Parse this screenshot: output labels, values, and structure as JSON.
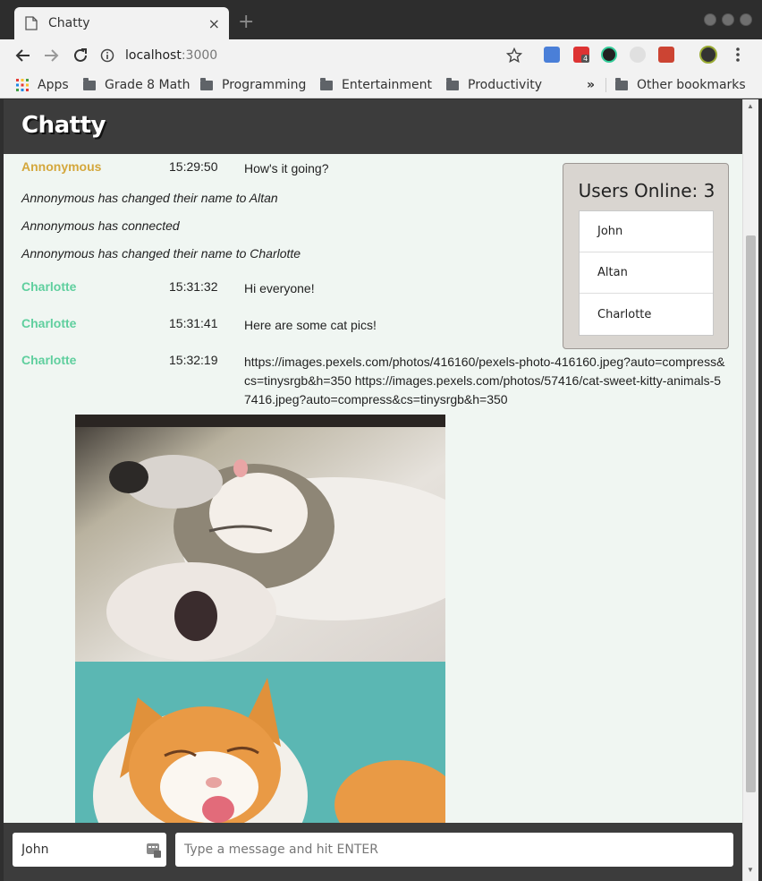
{
  "browser": {
    "tab_title": "Chatty",
    "new_tab_symbol": "+",
    "url_host": "localhost",
    "url_port": ":3000",
    "bookmarks": [
      "Apps",
      "Grade 8 Math",
      "Programming",
      "Entertainment",
      "Productivity"
    ],
    "overflow_label": "»",
    "other_bookmarks": "Other bookmarks",
    "extension_badge": "4"
  },
  "app": {
    "title": "Chatty",
    "colors": {
      "anonymous": "#d4a73c",
      "charlotte": "#5fcf9e",
      "header": "#3c3c3c",
      "background": "#f0f6f2"
    }
  },
  "messages": [
    {
      "type": "chat",
      "user": "Annonymous",
      "time": "15:29:50",
      "text": "How's it going?"
    },
    {
      "type": "system",
      "text": "Annonymous has changed their name to Altan"
    },
    {
      "type": "system",
      "text": "Annonymous has connected"
    },
    {
      "type": "system",
      "text": "Annonymous has changed their name to Charlotte"
    },
    {
      "type": "chat",
      "user": "Charlotte",
      "time": "15:31:32",
      "text": "Hi everyone!"
    },
    {
      "type": "chat",
      "user": "Charlotte",
      "time": "15:31:41",
      "text": "Here are some cat pics!"
    },
    {
      "type": "chat",
      "user": "Charlotte",
      "time": "15:32:19",
      "text": "https://images.pexels.com/photos/416160/pexels-photo-416160.jpeg?auto=compress&cs=tinysrgb&h=350 https://images.pexels.com/photos/57416/cat-sweet-kitty-animals-57416.jpeg?auto=compress&cs=tinysrgb&h=350"
    }
  ],
  "users_online": {
    "title": "Users Online: 3",
    "users": [
      "John",
      "Altan",
      "Charlotte"
    ]
  },
  "chatbar": {
    "username_value": "John",
    "message_placeholder": "Type a message and hit ENTER"
  }
}
